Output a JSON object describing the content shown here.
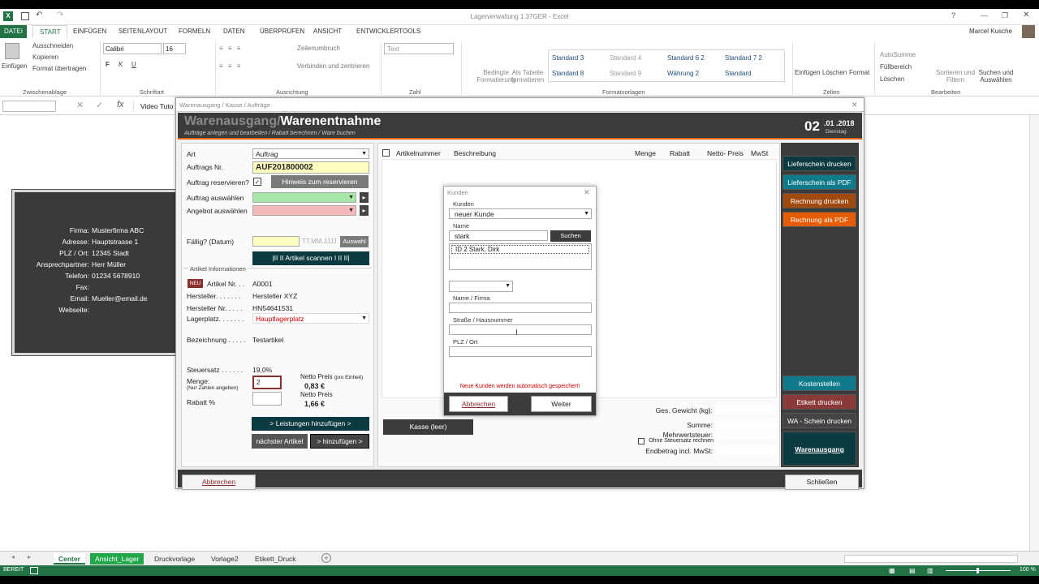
{
  "app": {
    "title": "Lagerverwaltung 1.37GER - Excel",
    "user": "Marcel Kusche"
  },
  "menu": [
    "DATEI",
    "START",
    "EINFÜGEN",
    "SEITENLAYOUT",
    "FORMELN",
    "DATEN",
    "ÜBERPRÜFEN",
    "ANSICHT",
    "ENTWICKLERTOOLS"
  ],
  "ribbon": {
    "clipboard": {
      "paste": "Einfügen",
      "cut": "Ausschneiden",
      "copy": "Kopieren",
      "painter": "Format übertragen",
      "label": "Zwischenablage"
    },
    "font": {
      "name": "Calibri",
      "size": "16",
      "label": "Schriftart",
      "bold": "F",
      "italic": "K",
      "underline": "U"
    },
    "alignment": {
      "wrap": "Zeilenumbruch",
      "merge": "Verbinden und zentrieren",
      "label": "Ausrichtung"
    },
    "number": {
      "format": "Text",
      "label": "Zahl"
    },
    "cond": "Bedingte Formatierung",
    "astable": "Als Tabelle formatieren",
    "styles": {
      "items": [
        "Standard 3",
        "Standard 4",
        "Standard 6 2",
        "Standard 7 2",
        "Standard 8",
        "Standard 9",
        "Währung 2",
        "Standard"
      ],
      "label": "Formatvorlagen"
    },
    "cells": {
      "insert": "Einfügen",
      "delete": "Löschen",
      "format": "Format",
      "label": "Zellen"
    },
    "edit": {
      "autosum": "AutoSumme",
      "fill": "Füllbereich",
      "clear": "Löschen",
      "sort": "Sortieren und Filtern",
      "find": "Suchen und Auswählen",
      "label": "Bearbeiten"
    }
  },
  "formula": {
    "fx": "fx",
    "value": "Video Tuto"
  },
  "card": {
    "rows": [
      {
        "label": "Firma:",
        "value": "Musterfirma ABC"
      },
      {
        "label": "Adresse:",
        "value": "Hauptstrasse 1"
      },
      {
        "label": "PLZ / Ort:",
        "value": "12345 Stadt"
      },
      {
        "label": "Ansprechpartner:",
        "value": "Herr Müller"
      },
      {
        "label": "Telefon:",
        "value": "01234 5678910"
      },
      {
        "label": "Fax:",
        "value": ""
      },
      {
        "label": "Email:",
        "value": "Mueller@email.de"
      },
      {
        "label": "Webseite:",
        "value": ""
      }
    ]
  },
  "form": {
    "caption": "Warenausgang / Kasse / Aufträge",
    "title1": "Warenausgang",
    "slash": "/",
    "title2": "Warenentnahme",
    "subtitle": "Aufträge anlegen und bearbeiten / Rabatt berechnen / Ware buchen",
    "date_day": "02",
    "date_rest": ".01 .2018",
    "weekday": "Dienstag",
    "art_label": "Art",
    "art_value": "Auftrag",
    "nr_label": "Auftrags Nr.",
    "nr_value": "AUF201800002",
    "reserve_label": "Auftrag reservieren?",
    "reserve_btn": "Hinweis zum reservieren",
    "select_order": "Auftrag auswählen",
    "select_offer": "Angebot auswählen",
    "due_label": "Fällig? (Datum)",
    "due_placeholder": "TT.MM.JJJJ",
    "due_btn": "Auswahl",
    "scan_btn": "|II II Artikel scannen I II II|",
    "info_label": "Artikel Informationen",
    "new_badge": "NEU",
    "article_label": "Artikel Nr. . .",
    "article_value": "A0001",
    "maker_label": "Hersteller. . . . . . .",
    "maker_value": "Hersteller XYZ",
    "makernr_label": "Hersteller Nr. . . . .",
    "makernr_value": "HN54641531",
    "place_label": "Lagerplatz. . . . . . .",
    "place_value": "Hauptlagerplatz",
    "desc_label": "Bezeichnung . . . . .",
    "desc_value": "Testartikel",
    "tax_label": "Steuersatz . . . . . .",
    "tax_value": "19,0%",
    "qty_label": "Menge:",
    "qty_hint": "(Nur Zahlen angeben)",
    "qty_value": "2",
    "discount_label": "Rabatt %",
    "net_unit_label": "Netto Preis",
    "net_unit_hint": "(pro Einheit)",
    "net_unit_value": "0,83 €",
    "net_label": "Netto Preis",
    "net_value": "1,66 €",
    "services_btn": "> Leistungen hinzufügen >",
    "next_btn": "nächster Artikel",
    "add_btn": "> hinzufügen >",
    "cols": [
      "Artikelnummer",
      "Beschreibung",
      "Menge",
      "Rabatt",
      "Netto- Preis",
      "MwSt"
    ],
    "kasse_btn": "Kasse (leer)",
    "weight_label": "Ges. Gewicht (kg):",
    "sum_label": "Summe:",
    "vat_label": "Mehrwertsteuer:",
    "novat_label": "Ohne Steuersatz rechnen",
    "total_label": "Endbetrag incl. MwSt:",
    "side": [
      "Lieferschein drucken",
      "Lieferschein als PDF",
      "Rechnung drucken",
      "Rechnung als PDF"
    ],
    "side2": [
      "Kostenstellen",
      "Etikett drucken",
      "WA - Schein drucken"
    ],
    "main_btn": "Warenausgang",
    "cancel": "Abbrechen",
    "close": "Schließen"
  },
  "dialog": {
    "title": "Kunden",
    "kunden_label": "Kunden",
    "kunden_value": "neuer Kunde",
    "name_label": "Name",
    "name_value": "stark",
    "search_btn": "Suchen",
    "result": "ID 2 Stark, Dirk",
    "firm_label": "Name / Firma",
    "street_label": "Straße / Hausnummer",
    "city_label": "PLZ / Ort",
    "note": "Neue Kunden werden automatisch gespeichert!",
    "cancel": "Abbrechen",
    "next": "Weiter"
  },
  "tabs": [
    "Center",
    "Ansicht_Lager",
    "Druckvorlage",
    "Vorlage2",
    "Etikett_Druck"
  ],
  "status": {
    "ready": "BEREIT",
    "zoom": "100 %"
  },
  "colors": {
    "excel": "#217346",
    "accent": "#e65c00",
    "teal": "#0e6b78",
    "brown": "#a04a10",
    "orange": "#e65c00",
    "dark": "#3b3b3b"
  }
}
